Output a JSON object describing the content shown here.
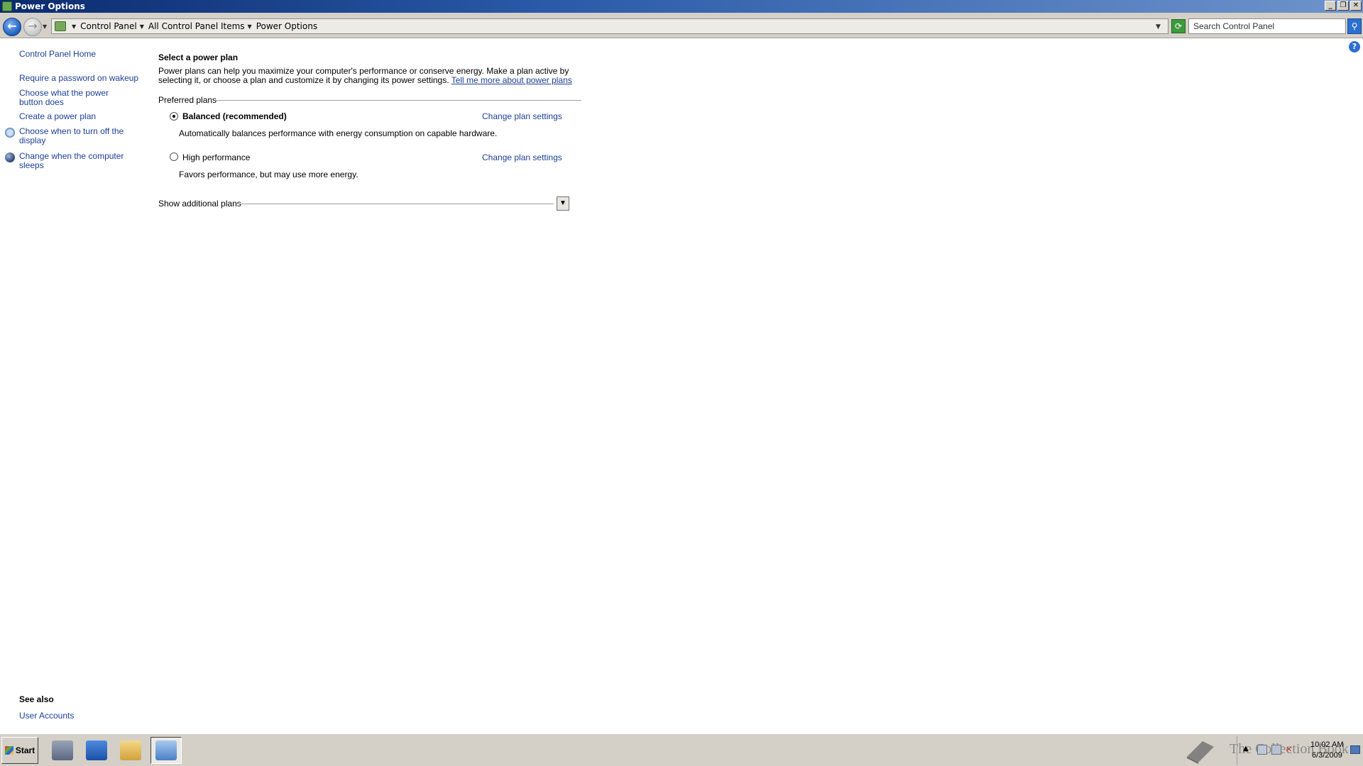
{
  "window": {
    "title": "Power Options",
    "buttons": {
      "minimize": "_",
      "restore": "❐",
      "close": "✕"
    }
  },
  "address_bar": {
    "breadcrumbs": [
      "Control Panel",
      "All Control Panel Items",
      "Power Options"
    ],
    "search_placeholder": "Search Control Panel"
  },
  "sidebar": {
    "items": [
      {
        "label": "Control Panel Home",
        "icon": ""
      },
      {
        "label": "Require a password on wakeup",
        "icon": ""
      },
      {
        "label": "Choose what the power button does",
        "icon": ""
      },
      {
        "label": "Create a power plan",
        "icon": ""
      },
      {
        "label": "Choose when to turn off the display",
        "icon": "monitor-icon"
      },
      {
        "label": "Change when the computer sleeps",
        "icon": "moon-icon"
      }
    ],
    "see_also_title": "See also",
    "see_also_items": [
      "User Accounts"
    ]
  },
  "main": {
    "title": "Select a power plan",
    "description": "Power plans can help you maximize your computer's performance or conserve energy. Make a plan active by selecting it, or choose a plan and customize it by changing its power settings.",
    "description_link": "Tell me more about power plans",
    "preferred_label": "Preferred plans",
    "plans": [
      {
        "name": "Balanced (recommended)",
        "selected": true,
        "description": "Automatically balances performance with energy consumption on capable hardware.",
        "change_label": "Change plan settings"
      },
      {
        "name": "High performance",
        "selected": false,
        "description": "Favors performance, but may use more energy.",
        "change_label": "Change plan settings"
      }
    ],
    "additional_label": "Show additional plans"
  },
  "taskbar": {
    "start_label": "Start",
    "apps": [
      "server-manager-icon",
      "powershell-icon",
      "explorer-icon",
      "control-panel-icon"
    ],
    "clock": {
      "time": "10:02 AM",
      "date": "6/3/2009"
    },
    "watermark": "The Collection Book"
  }
}
